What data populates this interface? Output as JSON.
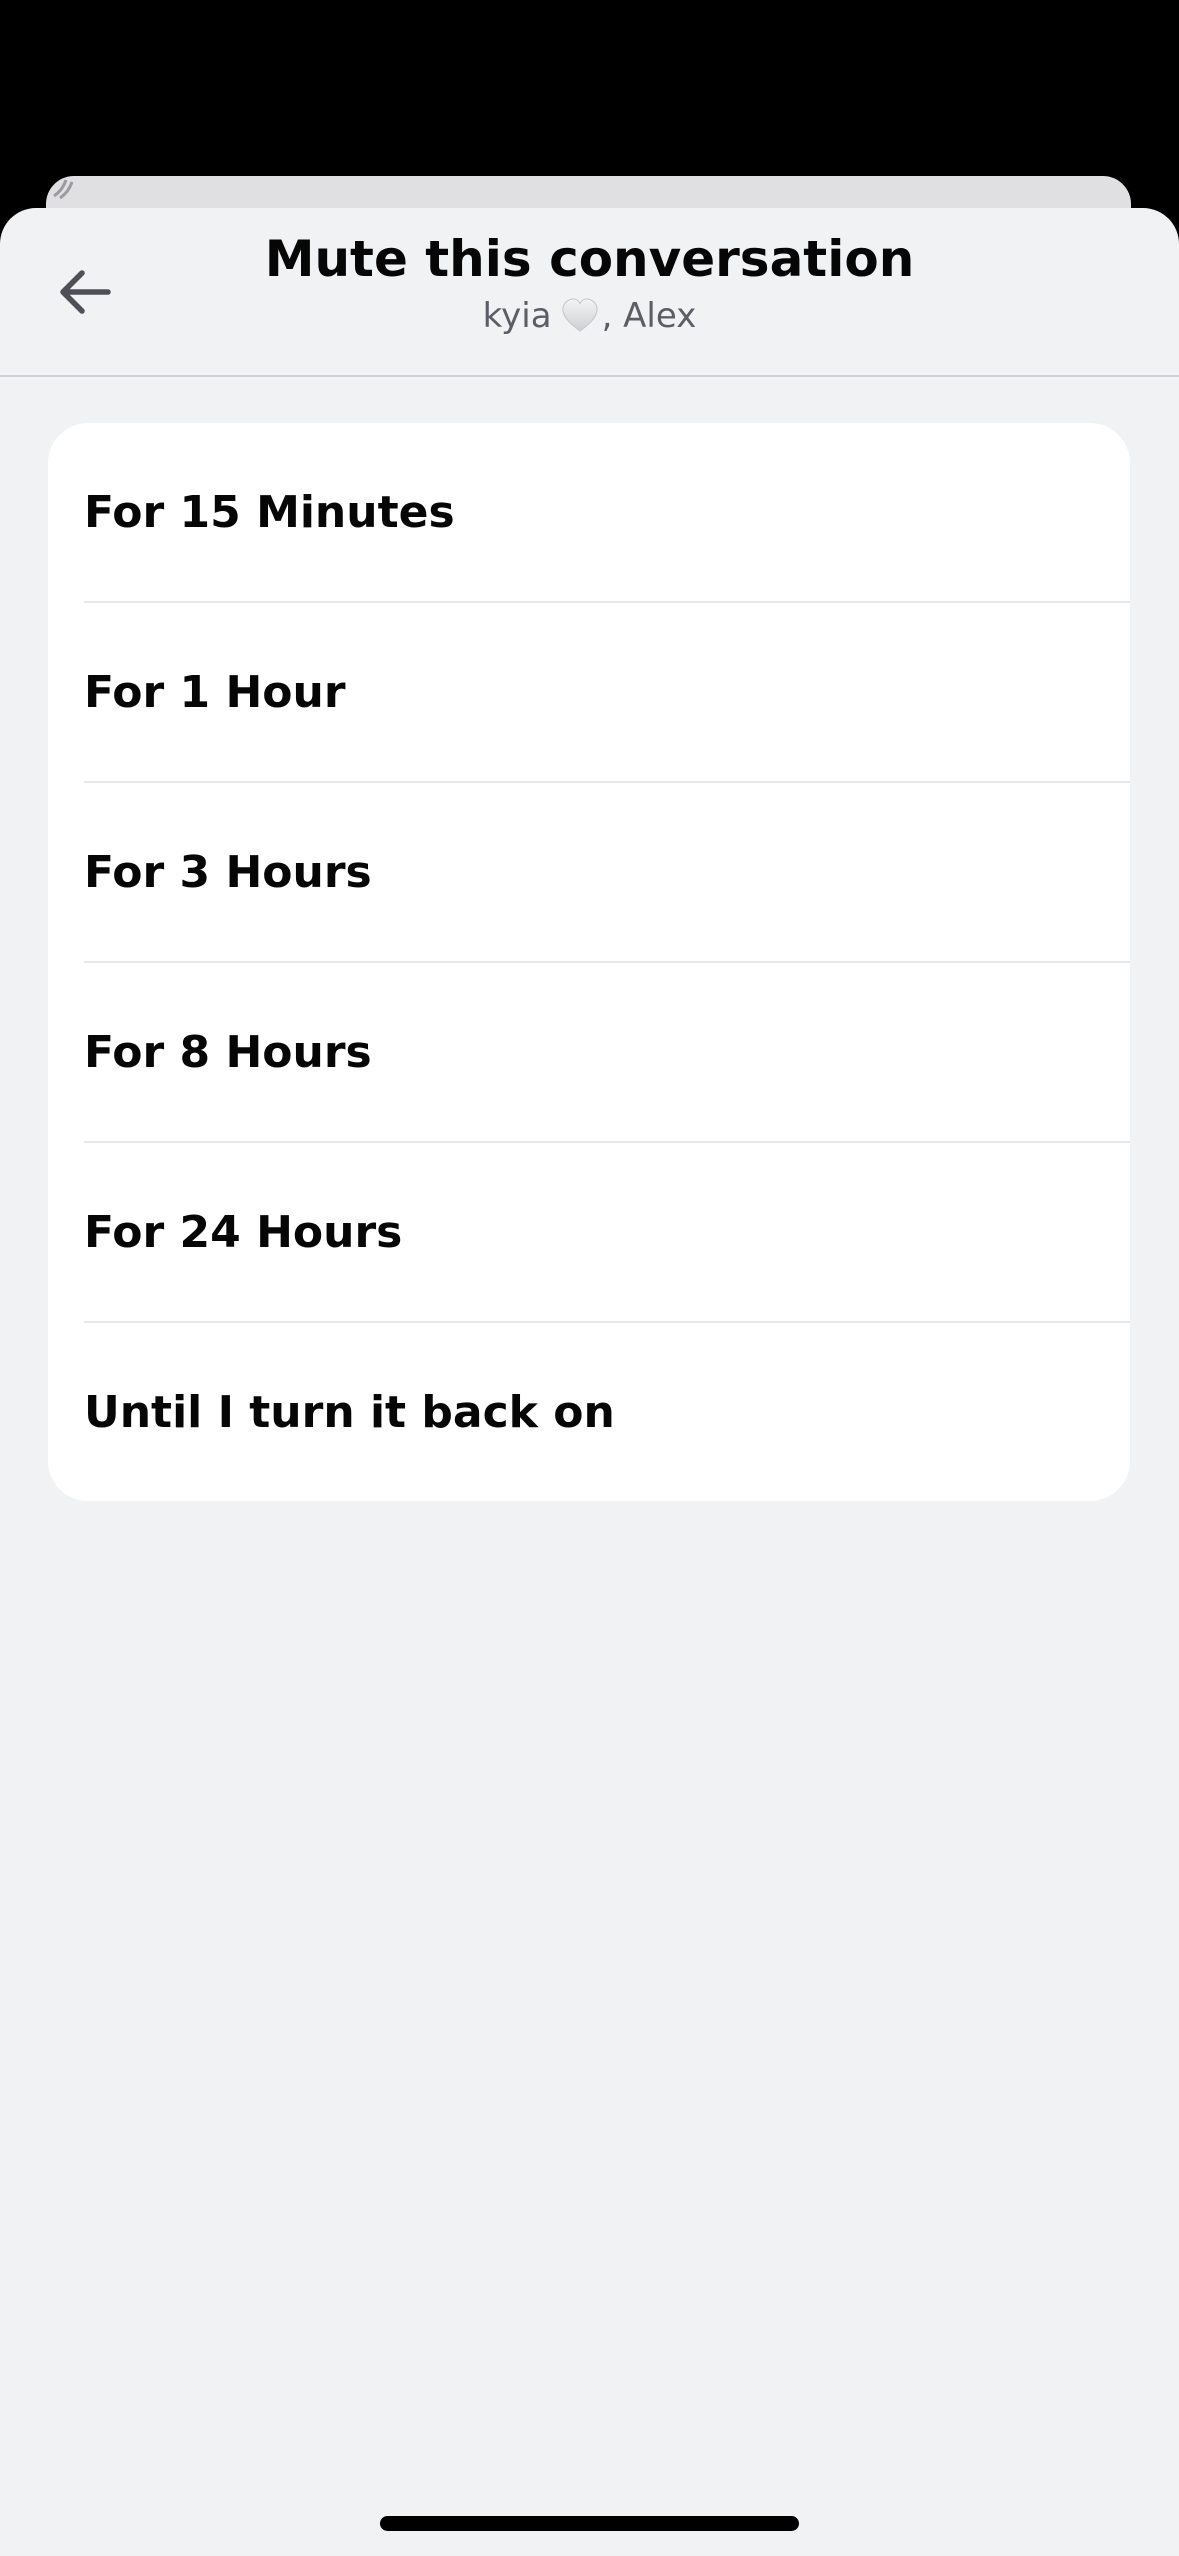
{
  "sheet": {
    "title": "Mute this conversation",
    "subtitle_before": "kyia",
    "subtitle_after": ", Alex",
    "back_icon": "arrow-left-icon",
    "heart_icon": "white-heart-icon"
  },
  "options": [
    {
      "label": "For 15 Minutes"
    },
    {
      "label": "For 1 Hour"
    },
    {
      "label": "For 3 Hours"
    },
    {
      "label": "For 8 Hours"
    },
    {
      "label": "For 24 Hours"
    },
    {
      "label": "Until I turn it back on"
    }
  ],
  "colors": {
    "background": "#f1f2f4",
    "card": "#ffffff",
    "text": "#060607",
    "subtext": "#5c5e66"
  }
}
